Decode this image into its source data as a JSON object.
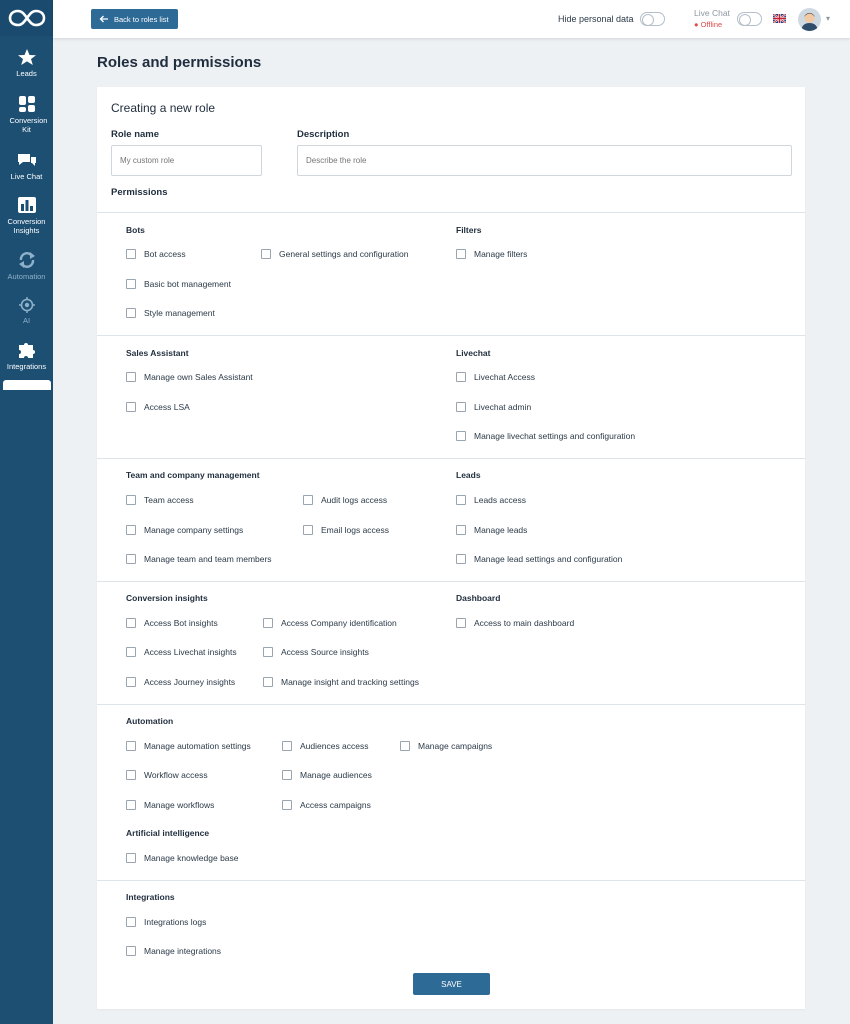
{
  "sidebar": {
    "items": [
      {
        "label": "Leads",
        "icon": "person-star-icon"
      },
      {
        "label": "Conversion Kit",
        "icon": "widgets-icon"
      },
      {
        "label": "Live Chat",
        "icon": "chat-bubbles-icon"
      },
      {
        "label": "Conversion Insights",
        "icon": "bar-chart-icon"
      },
      {
        "label": "Automation",
        "icon": "cycle-icon"
      },
      {
        "label": "AI",
        "icon": "ai-chip-icon"
      },
      {
        "label": "Integrations",
        "icon": "puzzle-icon"
      }
    ]
  },
  "topbar": {
    "back_label": "Back to roles list",
    "hide_label": "Hide personal data",
    "livechat_label": "Live Chat",
    "livechat_status": "Offline"
  },
  "page_title": "Roles and permissions",
  "form": {
    "title": "Creating a new role",
    "role_name_label": "Role name",
    "role_name_placeholder": "My custom role",
    "description_label": "Description",
    "description_placeholder": "Describe the role",
    "permissions_label": "Permissions"
  },
  "sections": {
    "bots": {
      "title": "Bots",
      "items": [
        "Bot access",
        "General settings and configuration",
        "Basic bot management",
        "Style management"
      ]
    },
    "filters": {
      "title": "Filters",
      "items": [
        "Manage filters"
      ]
    },
    "sales": {
      "title": "Sales Assistant",
      "items": [
        "Manage own Sales Assistant",
        "Access LSA"
      ]
    },
    "livechat": {
      "title": "Livechat",
      "items": [
        "Livechat Access",
        "Livechat admin",
        "Manage livechat settings and configuration"
      ]
    },
    "team": {
      "title": "Team and company management",
      "items": [
        "Team access",
        "Audit logs access",
        "Manage company settings",
        "Email logs access",
        "Manage team and team members"
      ]
    },
    "leads": {
      "title": "Leads",
      "items": [
        "Leads access",
        "Manage leads",
        "Manage lead settings and configuration"
      ]
    },
    "insights": {
      "title": "Conversion insights",
      "items": [
        "Access Bot insights",
        "Access Company identification",
        "Access Livechat insights",
        "Access Source insights",
        "Access Journey insights",
        "Manage insight and tracking settings"
      ]
    },
    "dashboard": {
      "title": "Dashboard",
      "items": [
        "Access to main dashboard"
      ]
    },
    "automation": {
      "title": "Automation",
      "items": [
        "Manage automation settings",
        "Audiences access",
        "Manage campaigns",
        "Workflow access",
        "Manage audiences",
        "Manage workflows",
        "Access campaigns"
      ]
    },
    "ai": {
      "title": "Artificial intelligence",
      "items": [
        "Manage knowledge base"
      ]
    },
    "integrations": {
      "title": "Integrations",
      "items": [
        "Integrations logs",
        "Manage integrations"
      ]
    }
  },
  "save_label": "SAVE",
  "colors": {
    "sidebar": "#1d4f73",
    "primary": "#2d6a96",
    "offline": "#e04b4b"
  }
}
